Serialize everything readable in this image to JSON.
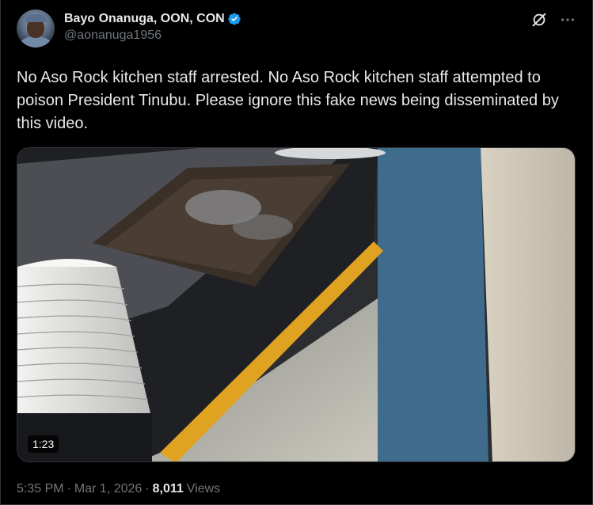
{
  "author": {
    "display_name": "Bayo Onanuga, OON, CON",
    "handle": "@aonanuga1956"
  },
  "tweet": {
    "text": "No Aso Rock kitchen staff arrested. No Aso Rock kitchen staff attempted to poison President Tinubu. Please ignore this fake news being disseminated by this video."
  },
  "media": {
    "duration": "1:23"
  },
  "meta": {
    "time": "5:35 PM",
    "separator": "·",
    "date": "Mar 1, 2026",
    "views_count": "8,011",
    "views_label": "Views"
  },
  "icons": {
    "verified": "verified-badge-icon",
    "grok": "grok-icon",
    "more": "more-icon"
  },
  "colors": {
    "background": "#000000",
    "text": "#e7e9ea",
    "secondary_text": "#71767b",
    "verified_blue": "#1d9bf0"
  }
}
